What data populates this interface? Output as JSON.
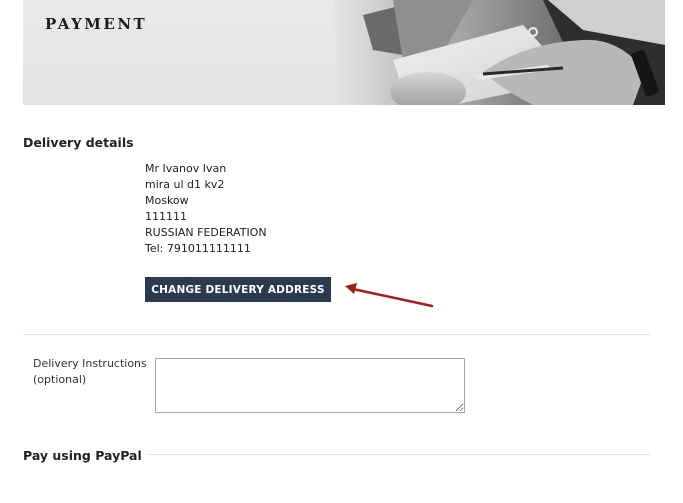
{
  "banner": {
    "title": "PAYMENT"
  },
  "delivery": {
    "heading": "Delivery details",
    "address_lines": [
      "Mr Ivanov Ivan",
      "mira ul d1 kv2",
      "Moskow",
      "111111",
      "RUSSIAN FEDERATION",
      "Tel: 791011111111"
    ],
    "change_button_label": "CHANGE DELIVERY ADDRESS"
  },
  "instructions": {
    "label_line1": "Delivery Instructions",
    "label_line2": "(optional)",
    "value": ""
  },
  "paypal": {
    "heading": "Pay using PayPal"
  },
  "colors": {
    "button_bg": "#2b3a4e",
    "arrow": "#a41c1c"
  }
}
